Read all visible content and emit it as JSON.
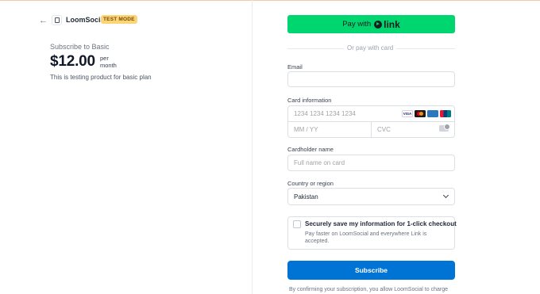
{
  "header": {
    "back_icon": "arrow-left-icon",
    "logo_icon": "app-window-icon",
    "brand": "LoomSocial",
    "mode_badge": "TEST MODE"
  },
  "summary": {
    "subscribe_title": "Subscribe to Basic",
    "price": "$12.00",
    "per_line1": "per",
    "per_line2": "month",
    "description": "This is testing product for basic plan"
  },
  "link_pay": {
    "label": "Pay with",
    "brand": "link",
    "color": "#00d66f"
  },
  "divider_text": "Or pay with card",
  "form": {
    "email_label": "Email",
    "email_value": "",
    "card_label": "Card information",
    "card_placeholder": "1234 1234 1234 1234",
    "expiry_placeholder": "MM / YY",
    "cvc_placeholder": "CVC",
    "card_brands": [
      "VISA",
      "mastercard",
      "AMEX",
      "UnionPay"
    ],
    "cardholder_label": "Cardholder name",
    "cardholder_placeholder": "Full name on card",
    "country_label": "Country or region",
    "country_value": "Pakistan"
  },
  "save_info": {
    "title": "Securely save my information for 1-click checkout",
    "description": "Pay faster on LoomSocial and everywhere Link is accepted.",
    "checked": false
  },
  "subscribe_button": {
    "label": "Subscribe",
    "color": "#0074d4"
  },
  "terms": "By confirming your subscription, you allow LoomSocial to charge"
}
